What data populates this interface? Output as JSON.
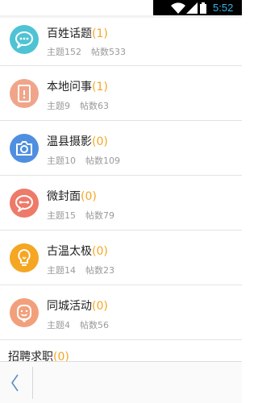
{
  "status_bar": {
    "time": "5:52"
  },
  "forums": [
    {
      "name": "百姓话题",
      "count": "(1)",
      "topics_label": "主题152",
      "posts_label": "帖数533",
      "icon": "chat-bubble-icon",
      "color": "#4fc3d3"
    },
    {
      "name": "本地问事",
      "count": "(1)",
      "topics_label": "主题9",
      "posts_label": "帖数63",
      "icon": "door-icon",
      "color": "#f0a58a"
    },
    {
      "name": "温县摄影",
      "count": "(0)",
      "topics_label": "主题10",
      "posts_label": "帖数109",
      "icon": "camera-icon",
      "color": "#4f8fe0"
    },
    {
      "name": "微封面",
      "count": "(0)",
      "topics_label": "主题15",
      "posts_label": "帖数79",
      "icon": "share-bubble-icon",
      "color": "#ee7a6a"
    },
    {
      "name": "古温太极",
      "count": "(0)",
      "topics_label": "主题14",
      "posts_label": "帖数23",
      "icon": "lightbulb-icon",
      "color": "#f5a623"
    },
    {
      "name": "同城活动",
      "count": "(0)",
      "topics_label": "主题4",
      "posts_label": "帖数56",
      "icon": "smiley-icon",
      "color": "#f2a07c"
    }
  ],
  "section": {
    "name": "招聘求职",
    "count": "(0)"
  },
  "bottom_bar": {
    "back_icon": "back-chevron-icon"
  }
}
